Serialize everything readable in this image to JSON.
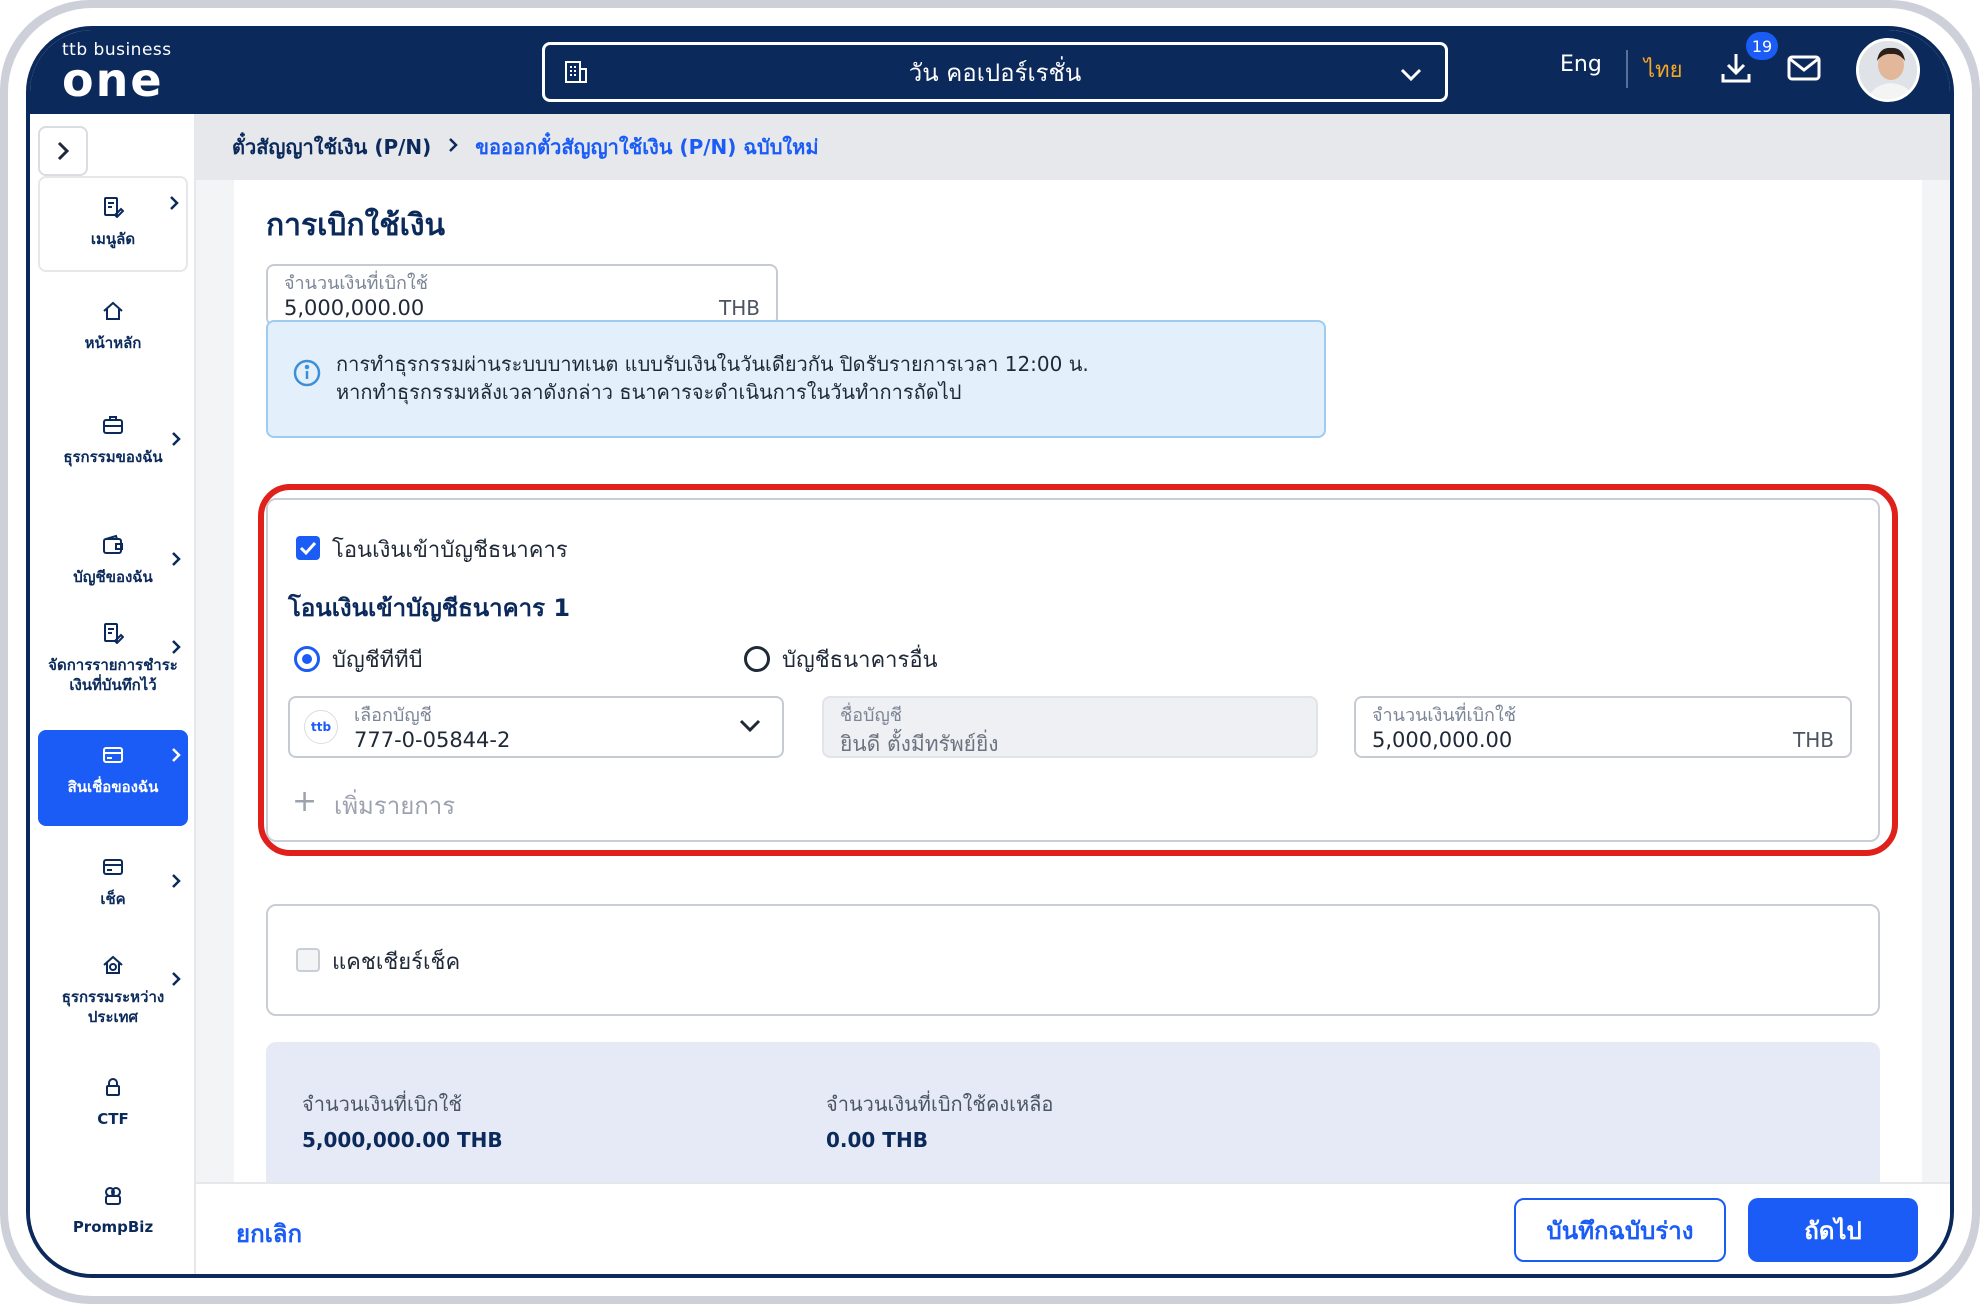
{
  "header": {
    "logo_brand": "ttb business",
    "logo_product": "one",
    "company": "วัน คอเปอร์เรชั่น",
    "lang_en": "Eng",
    "lang_th": "ไทย",
    "download_count": "19"
  },
  "sidebar": {
    "items": [
      {
        "label": "เมนูลัด"
      },
      {
        "label": "หน้าหลัก"
      },
      {
        "label": "ธุรกรรมของฉัน"
      },
      {
        "label": "บัญชีของฉัน"
      },
      {
        "label": "จัดการรายการชำระเงินที่บันทึกไว้"
      },
      {
        "label": "สินเชื่อของฉัน"
      },
      {
        "label": "เช็ค"
      },
      {
        "label": "ธุรกรรมระหว่างประเทศ"
      },
      {
        "label": "CTF"
      },
      {
        "label": "PrompBiz"
      }
    ]
  },
  "breadcrumb": {
    "parent": "ตั๋วสัญญาใช้เงิน (P/N)",
    "current": "ขอออกตั๋วสัญญาใช้เงิน (P/N) ฉบับใหม่"
  },
  "page": {
    "title": "การเบิกใช้เงิน",
    "amount_label": "จำนวนเงินที่เบิกใช้",
    "amount_value": "5,000,000.00",
    "currency": "THB",
    "info_line1": "การทำธุรกรรมผ่านระบบบาทเนต แบบรับเงินในวันเดียวกัน ปิดรับรายการเวลา 12:00 น.",
    "info_line2": "หากทำธุรกรรมหลังเวลาดังกล่าว ธนาคารจะดำเนินการในวันทำการถัดไป"
  },
  "transfer": {
    "checkbox_label": "โอนเงินเข้าบัญชีธนาคาร",
    "section_title": "โอนเงินเข้าบัญชีธนาคาร 1",
    "radio_ttb": "บัญชีทีทีบี",
    "radio_other": "บัญชีธนาคารอื่น",
    "select_label": "เลือกบัญชี",
    "select_value": "777-0-05844-2",
    "bank_chip": "ttb",
    "name_label": "ชื่อบัญชี",
    "name_value": "ยินดี ตั้งมีทรัพย์ยิ่ง",
    "amount_label": "จำนวนเงินที่เบิกใช้",
    "amount_value": "5,000,000.00",
    "currency": "THB",
    "add_item": "เพิ่มรายการ"
  },
  "cashier": {
    "checkbox_label": "แคชเชียร์เช็ค"
  },
  "summary": {
    "drawn_label": "จำนวนเงินที่เบิกใช้",
    "drawn_value": "5,000,000.00 THB",
    "remaining_label": "จำนวนเงินที่เบิกใช้คงเหลือ",
    "remaining_value": "0.00 THB"
  },
  "footer": {
    "cancel": "ยกเลิก",
    "save_draft": "บันทึกฉบับร่าง",
    "next": "ถัดไป"
  },
  "colors": {
    "navy": "#0b2a5b",
    "primary": "#1a5cf5",
    "highlight": "#e0201b",
    "lang_active": "#f5a623"
  }
}
